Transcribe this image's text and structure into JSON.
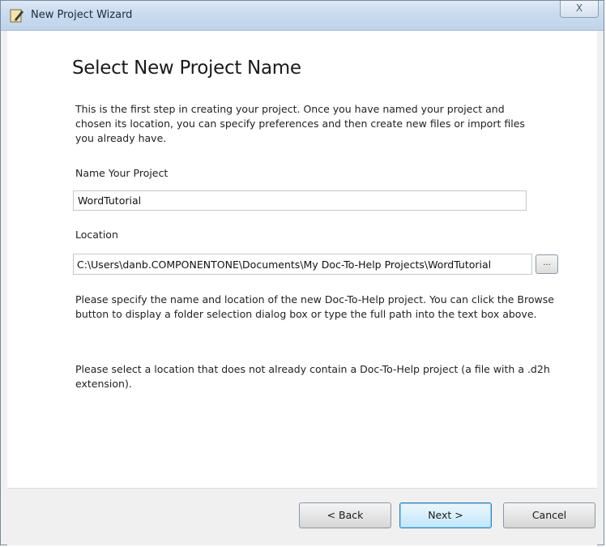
{
  "window": {
    "title": "New Project Wizard",
    "app_icon": "pencil-book-icon",
    "close_glyph": "X"
  },
  "page": {
    "heading": "Select New Project Name",
    "intro": "This is the first step in creating your project. Once you have named your project and chosen its location, you can specify preferences and then create new files or import files you already have.",
    "name_label": "Name Your Project",
    "name_value": "WordTutorial",
    "location_label": "Location",
    "location_value": "C:\\Users\\danb.COMPONENTONE\\Documents\\My Doc-To-Help Projects\\WordTutorial",
    "browse_label": "...",
    "help1": "Please specify the name and location of the new Doc-To-Help project. You can click the Browse button to display a folder selection dialog box or type the full path into the text box above.",
    "help2": "Please select a location that does not already contain a Doc-To-Help project (a file with a .d2h extension)."
  },
  "buttons": {
    "back": "< Back",
    "next": "Next >",
    "cancel": "Cancel"
  }
}
